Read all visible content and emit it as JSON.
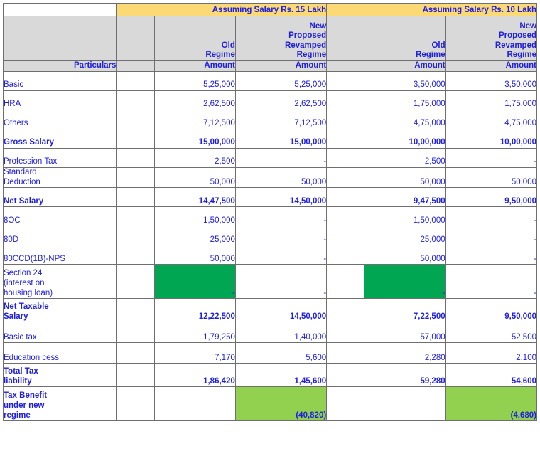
{
  "header": {
    "blank_corner": "",
    "bands": [
      {
        "label": "Assuming Salary Rs. 15 Lakh"
      },
      {
        "label": "Assuming Salary Rs. 10 Lakh"
      }
    ],
    "particulars_label": "Particulars",
    "regimes": {
      "old": "Old\nRegime",
      "old_line1": "Old",
      "old_line2": "Regime",
      "new_line1": "New",
      "new_line2": "Proposed",
      "new_line3": "Revamped",
      "new_line4": "Regime",
      "amount": "Amount"
    }
  },
  "colors": {
    "band_yellow": "#FBD975",
    "header_gray": "#D9D9D9",
    "text_blue": "#2020E0",
    "green_dark": "#00A651",
    "green_light": "#92D050",
    "border": "#6F6F6F"
  },
  "table_data": {
    "type": "table",
    "title": "Assuming Salary Rs. 15 Lakh / Assuming Salary Rs. 10 Lakh",
    "columns": [
      "Particulars",
      "15L Old Regime Amount",
      "15L New Proposed Revamped Regime Amount",
      "10L Old Regime Amount",
      "10L New Proposed Revamped Regime Amount"
    ],
    "rows": [
      {
        "label": "Basic",
        "bold": false,
        "c15old": "5,25,000",
        "c15new": "5,25,000",
        "c10old": "3,50,000",
        "c10new": "3,50,000"
      },
      {
        "label": "HRA",
        "bold": false,
        "c15old": "2,62,500",
        "c15new": "2,62,500",
        "c10old": "1,75,000",
        "c10new": "1,75,000"
      },
      {
        "label": "Others",
        "bold": false,
        "c15old": "7,12,500",
        "c15new": "7,12,500",
        "c10old": "4,75,000",
        "c10new": "4,75,000"
      },
      {
        "label": "Gross  Salary",
        "bold": true,
        "c15old": "15,00,000",
        "c15new": "15,00,000",
        "c10old": "10,00,000",
        "c10new": "10,00,000"
      },
      {
        "label": "Profession Tax",
        "bold": false,
        "c15old": "2,500",
        "c15new": "-",
        "c10old": "2,500",
        "c10new": "-"
      },
      {
        "label": "Standard Deduction",
        "bold": false,
        "c15old": "50,000",
        "c15new": "50,000",
        "c10old": "50,000",
        "c10new": "50,000"
      },
      {
        "label": "Net  Salary",
        "bold": true,
        "c15old": "14,47,500",
        "c15new": "14,50,000",
        "c10old": "9,47,500",
        "c10new": "9,50,000"
      },
      {
        "label": "8OC",
        "bold": false,
        "c15old": "1,50,000",
        "c15new": "-",
        "c10old": "1,50,000",
        "c10new": "-"
      },
      {
        "label": "80D",
        "bold": false,
        "c15old": "25,000",
        "c15new": "-",
        "c10old": "25,000",
        "c10new": "-"
      },
      {
        "label": "80CCD(1B)-NPS",
        "bold": false,
        "c15old": "50,000",
        "c15new": "-",
        "c10old": "50,000",
        "c10new": "-"
      },
      {
        "label": "Section  24 (interest on housing loan)",
        "bold": false,
        "c15old": "-",
        "c15new": "-",
        "c10old": "-",
        "c10new": "-"
      },
      {
        "label": "Net Taxable Salary",
        "bold": true,
        "c15old": "12,22,500",
        "c15new": "14,50,000",
        "c10old": "7,22,500",
        "c10new": "9,50,000"
      },
      {
        "label": "Basic tax",
        "bold": false,
        "c15old": "1,79,250",
        "c15new": "1,40,000",
        "c10old": "57,000",
        "c10new": "52,500"
      },
      {
        "label": "Education  cess",
        "bold": false,
        "c15old": "7,170",
        "c15new": "5,600",
        "c10old": "2,280",
        "c10new": "2,100"
      },
      {
        "label": "Total  Tax liability",
        "bold": true,
        "c15old": "1,86,420",
        "c15new": "1,45,600",
        "c10old": "59,280",
        "c10new": "54,600"
      },
      {
        "label": "Tax Benefit under new regime",
        "bold": true,
        "c15old": "",
        "c15new": "(40,820)",
        "c10old": "",
        "c10new": "(4,680)"
      }
    ]
  },
  "rows_text": {
    "basic": "Basic",
    "hra": "HRA",
    "others": "Others",
    "gross_salary": "Gross  Salary",
    "profession_tax": "Profession Tax",
    "standard_deduction_l1": "Standard",
    "standard_deduction_l2": "Deduction",
    "net_salary": "Net  Salary",
    "sec80c": "8OC",
    "sec80d": "80D",
    "sec80ccd": "80CCD(1B)-NPS",
    "section24_l1": "Section  24",
    "section24_l2": "(interest on",
    "section24_l3": "housing loan)",
    "net_taxable_l1": "Net Taxable",
    "net_taxable_l2": "Salary",
    "basic_tax": "Basic tax",
    "education_cess": "Education  cess",
    "total_tax_l1": "Total  Tax",
    "total_tax_l2": "liability",
    "benefit_l1": "Tax Benefit",
    "benefit_l2": "under new",
    "benefit_l3": "regime",
    "dash": "-",
    "empty": ""
  }
}
